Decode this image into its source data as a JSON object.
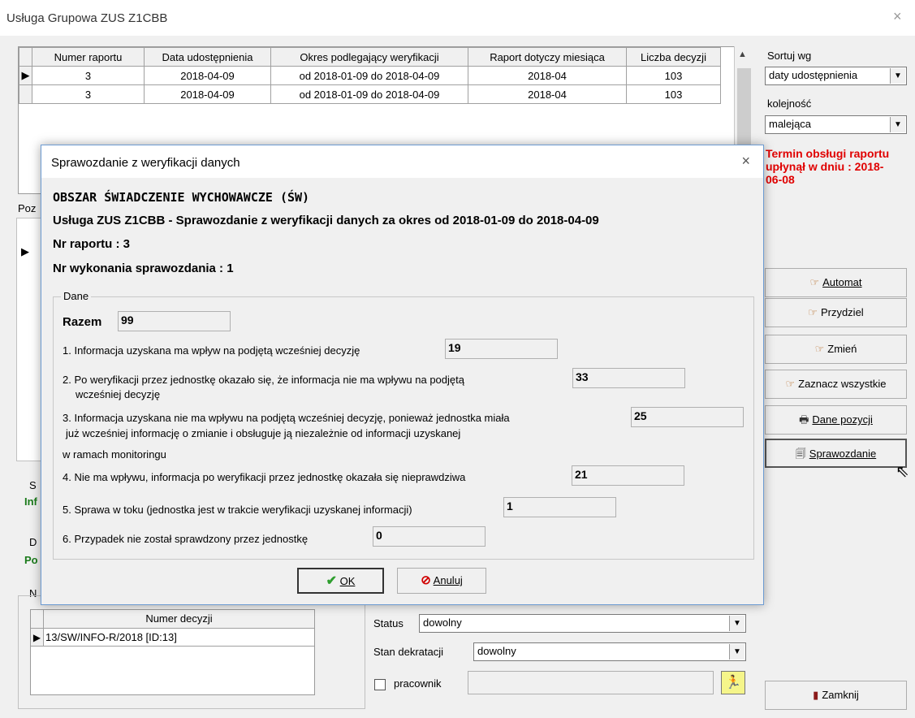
{
  "window": {
    "title": "Usługa Grupowa ZUS Z1CBB",
    "close": "×"
  },
  "top_table": {
    "headers": [
      "Numer raportu",
      "Data udostępnienia",
      "Okres podlegający weryfikacji",
      "Raport dotyczy miesiąca",
      "Liczba decyzji"
    ],
    "rows": [
      [
        "3",
        "2018-04-09",
        "od 2018-01-09 do 2018-04-09",
        "2018-04",
        "103"
      ],
      [
        "3",
        "2018-04-09",
        "od 2018-01-09 do 2018-04-09",
        "2018-04",
        "103"
      ]
    ]
  },
  "right_panel": {
    "sort_label": "Sortuj wg",
    "sort_value": "daty udostępnienia",
    "order_label": "kolejność",
    "order_value": "malejąca",
    "warning": "Termin obsługi raportu upłynął w dniu : 2018-06-08",
    "buttons": {
      "automat": "Automat",
      "przydziel": "Przydziel",
      "zmien": "Zmień",
      "zaznacz": "Zaznacz wszystkie",
      "dane": "Dane pozycji",
      "sprawozdanie": "Sprawozdanie",
      "zamknij": "Zamknij"
    }
  },
  "background": {
    "poz_label": "Poz",
    "s_label": "S",
    "inf_label": "Inf",
    "d_label": "D",
    "po_label": "Po",
    "n_label": "N",
    "decision_header": "Numer decyzji",
    "decision_row": "13/SW/INFO-R/2018 [ID:13]",
    "status_label": "Status",
    "status_value": "dowolny",
    "stan_label": "Stan dekratacji",
    "stan_value": "dowolny",
    "pracownik_label": "pracownik"
  },
  "dialog": {
    "title": "Sprawozdanie z weryfikacji danych",
    "heading": "OBSZAR ŚWIADCZENIE WYCHOWAWCZE (ŚW)",
    "subheading": "Usługa ZUS Z1CBB - Sprawozdanie z weryfikacji danych za okres od 2018-01-09 do 2018-04-09",
    "nr_raportu": "Nr raportu : 3",
    "nr_wykonania": "Nr wykonania sprawozdania : 1",
    "group_label": "Dane",
    "total_label": "Razem",
    "total_value": "99",
    "items": [
      {
        "text": "1. Informacja uzyskana ma wpływ na podjętą wcześniej decyzję",
        "value": "19"
      },
      {
        "text": "2. Po weryfikacji przez jednostkę okazało się, że informacja nie ma wpływu na podjętą",
        "text2": "wcześniej  decyzję",
        "value": "33"
      },
      {
        "text": "3. Informacja uzyskana nie ma wpływu na podjętą wcześniej decyzję, ponieważ  jednostka miała",
        "text2": "już wcześniej informację o zmianie i obsługuje ją niezależnie od informacji  uzyskanej",
        "text3": "w ramach monitoringu",
        "value": "25"
      },
      {
        "text": "4. Nie ma wpływu, informacja po weryfikacji przez jednostkę okazała się nieprawdziwa",
        "value": "21"
      },
      {
        "text": "5. Sprawa w toku (jednostka jest w trakcie weryfikacji uzyskanej informacji)",
        "value": "1"
      },
      {
        "text": "6. Przypadek nie został sprawdzony przez jednostkę",
        "value": "0"
      }
    ],
    "ok_label": "OK",
    "cancel_label": "Anuluj"
  },
  "colors": {
    "warning": "#e00000",
    "dialog_border": "#6c9bd2",
    "ok_check": "#2e9e2e",
    "cancel_icon": "#d00000"
  }
}
